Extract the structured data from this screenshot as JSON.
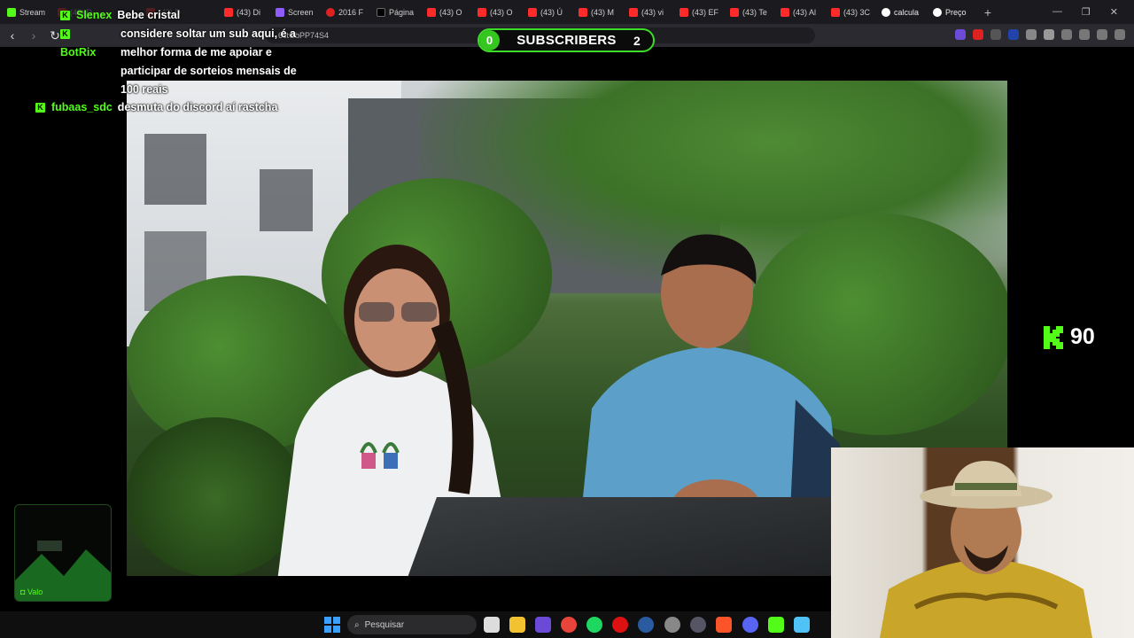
{
  "browser": {
    "tabs": [
      {
        "label": "Stream",
        "icon": "kick-icon"
      },
      {
        "label": "(43) D",
        "icon": "youtube-icon"
      },
      {
        "label": "(43) Di",
        "icon": "youtube-icon"
      },
      {
        "label": "Screen",
        "icon": "pen-icon"
      },
      {
        "label": "2016 F",
        "icon": "bank-icon"
      },
      {
        "label": "Página",
        "icon": "x-icon"
      },
      {
        "label": "(43) O",
        "icon": "youtube-icon"
      },
      {
        "label": "(43) O",
        "icon": "youtube-icon"
      },
      {
        "label": "(43) Ú",
        "icon": "youtube-icon"
      },
      {
        "label": "(43) M",
        "icon": "youtube-icon"
      },
      {
        "label": "(43) vi",
        "icon": "youtube-icon"
      },
      {
        "label": "(43) EF",
        "icon": "youtube-icon"
      },
      {
        "label": "(43) Te",
        "icon": "youtube-icon"
      },
      {
        "label": "(43) Al",
        "icon": "youtube-icon"
      },
      {
        "label": "(43) 3C",
        "icon": "youtube-icon"
      },
      {
        "label": "calcula",
        "icon": "google-icon"
      },
      {
        "label": "Preço",
        "icon": "page-icon"
      }
    ],
    "url": "6ctGbPP74S4"
  },
  "subscriber_goal": {
    "current": "0",
    "label": "SUBSCRIBERS",
    "target": "2",
    "accent": "#3ddc29"
  },
  "chat": [
    {
      "user": "Slenex",
      "message": "Bebe cristal"
    },
    {
      "user": "BotRix",
      "message": "considere soltar um sub aqui, é a melhor forma de me apoiar e participar de sorteios mensais de 100 reais"
    },
    {
      "user": "fubaas_sdc",
      "message": "desmuta do discord aí rastcha"
    }
  ],
  "viewers": {
    "count": "90",
    "accent": "#53fc18"
  },
  "mini_widget": {
    "label": "Valo"
  },
  "taskbar": {
    "search_placeholder": "Pesquisar"
  }
}
